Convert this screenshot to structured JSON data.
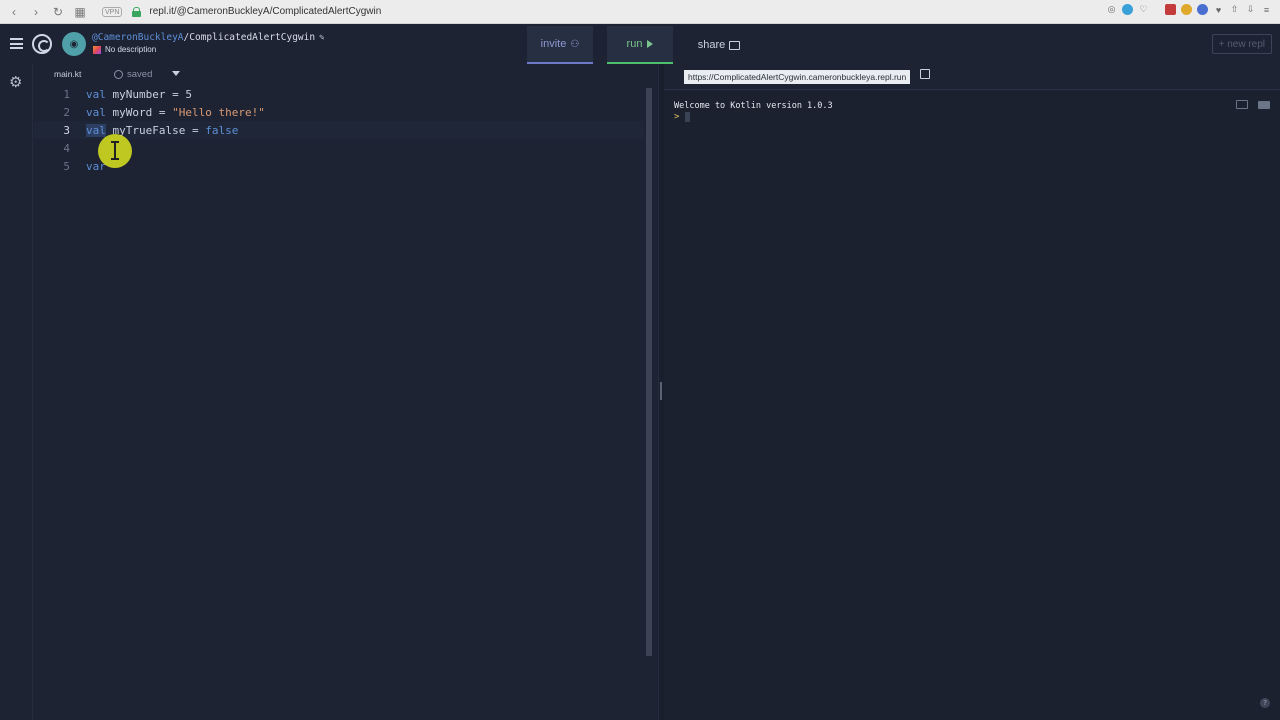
{
  "browser": {
    "url": "repl.it/@CameronBuckleyA/ComplicatedAlertCygwin",
    "vpn_label": "VPN"
  },
  "header": {
    "owner": "@CameronBuckleyA",
    "separator": "/",
    "repl_name": "ComplicatedAlertCygwin",
    "description": "No description",
    "invite_label": "invite",
    "run_label": "run",
    "share_label": "share",
    "new_repl_label": "+ new repl"
  },
  "editor": {
    "file_tab": "main.kt",
    "save_status": "saved",
    "lines": [
      {
        "number": "1",
        "kw": "val",
        "rest_name": "myNumber",
        "op": " = ",
        "value": "5"
      },
      {
        "number": "2",
        "kw": "val",
        "rest_name": "myWord",
        "op": " = ",
        "value": "\"Hello there!\""
      },
      {
        "number": "3",
        "kw": "val",
        "rest_name": "myTrueFalse",
        "op": " = ",
        "value": "false"
      },
      {
        "number": "4"
      },
      {
        "number": "5",
        "kw": "var"
      }
    ]
  },
  "console": {
    "url": "https://ComplicatedAlertCygwin.cameronbuckleya.repl.run",
    "welcome": "Welcome to Kotlin version 1.0.3",
    "prompt": ">"
  },
  "colors": {
    "keyword": "#5e8fd6",
    "string": "#d99a73",
    "run_accent": "#4cc06b",
    "invite_accent": "#6d79c9",
    "background": "#1d2333"
  }
}
